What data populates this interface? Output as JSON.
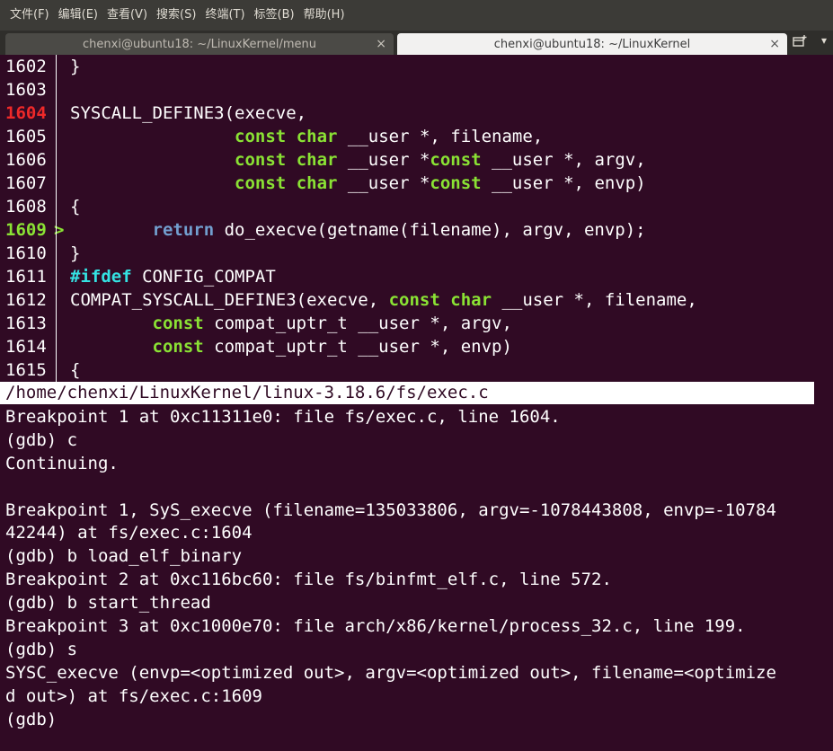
{
  "menubar": {
    "items": [
      "文件(F)",
      "编辑(E)",
      "查看(V)",
      "搜索(S)",
      "终端(T)",
      "标签(B)",
      "帮助(H)"
    ]
  },
  "tabs": [
    {
      "title": "chenxi@ubuntu18: ~/LinuxKernel/menu",
      "close": "×"
    },
    {
      "title": "chenxi@ubuntu18: ~/LinuxKernel",
      "close": "×"
    }
  ],
  "tab_menu": "▾",
  "code": [
    {
      "ln": "1602",
      "type": "normal",
      "parts": [
        [
          "",
          "}"
        ]
      ]
    },
    {
      "ln": "1603",
      "type": "normal",
      "parts": []
    },
    {
      "ln": "1604",
      "type": "bp",
      "parts": [
        [
          "",
          "SYSCALL_DEFINE3(execve,"
        ]
      ]
    },
    {
      "ln": "1605",
      "type": "normal",
      "parts": [
        [
          "",
          "                "
        ],
        [
          "kw",
          "const"
        ],
        [
          "",
          " "
        ],
        [
          "kw",
          "char"
        ],
        [
          "",
          " __user *, filename,"
        ]
      ]
    },
    {
      "ln": "1606",
      "type": "normal",
      "parts": [
        [
          "",
          "                "
        ],
        [
          "kw",
          "const"
        ],
        [
          "",
          " "
        ],
        [
          "kw",
          "char"
        ],
        [
          "",
          " __user *"
        ],
        [
          "kw",
          "const"
        ],
        [
          "",
          " __user *, argv,"
        ]
      ]
    },
    {
      "ln": "1607",
      "type": "normal",
      "parts": [
        [
          "",
          "                "
        ],
        [
          "kw",
          "const"
        ],
        [
          "",
          " "
        ],
        [
          "kw",
          "char"
        ],
        [
          "",
          " __user *"
        ],
        [
          "kw",
          "const"
        ],
        [
          "",
          " __user *, envp)"
        ]
      ]
    },
    {
      "ln": "1608",
      "type": "normal",
      "parts": [
        [
          "",
          "{"
        ]
      ]
    },
    {
      "ln": "1609",
      "type": "cur",
      "marker": ">",
      "parts": [
        [
          "",
          "        "
        ],
        [
          "kw2",
          "return"
        ],
        [
          "",
          " do_execve(getname(filename), argv, envp);"
        ]
      ]
    },
    {
      "ln": "1610",
      "type": "normal",
      "parts": [
        [
          "",
          "}"
        ]
      ]
    },
    {
      "ln": "1611",
      "type": "normal",
      "parts": [
        [
          "pp",
          "#ifdef"
        ],
        [
          "",
          " CONFIG_COMPAT"
        ]
      ]
    },
    {
      "ln": "1612",
      "type": "normal",
      "parts": [
        [
          "",
          "COMPAT_SYSCALL_DEFINE3(execve, "
        ],
        [
          "kw",
          "const"
        ],
        [
          "",
          " "
        ],
        [
          "kw",
          "char"
        ],
        [
          "",
          " __user *, filename,"
        ]
      ]
    },
    {
      "ln": "1613",
      "type": "normal",
      "parts": [
        [
          "",
          "        "
        ],
        [
          "kw",
          "const"
        ],
        [
          "",
          " compat_uptr_t __user *, argv,"
        ]
      ]
    },
    {
      "ln": "1614",
      "type": "normal",
      "parts": [
        [
          "",
          "        "
        ],
        [
          "kw",
          "const"
        ],
        [
          "",
          " compat_uptr_t __user *, envp)"
        ]
      ]
    },
    {
      "ln": "1615",
      "type": "normal",
      "parts": [
        [
          "",
          "{"
        ]
      ]
    }
  ],
  "status_bar": "/home/chenxi/LinuxKernel/linux-3.18.6/fs/exec.c",
  "gdb_output": [
    "Breakpoint 1 at 0xc11311e0: file fs/exec.c, line 1604.",
    "(gdb) c",
    "Continuing.",
    "",
    "Breakpoint 1, SyS_execve (filename=135033806, argv=-1078443808, envp=-10784",
    "42244) at fs/exec.c:1604",
    "(gdb) b load_elf_binary",
    "Breakpoint 2 at 0xc116bc60: file fs/binfmt_elf.c, line 572.",
    "(gdb) b start_thread",
    "Breakpoint 3 at 0xc1000e70: file arch/x86/kernel/process_32.c, line 199.",
    "(gdb) s",
    "SYSC_execve (envp=<optimized out>, argv=<optimized out>, filename=<optimize",
    "d out>) at fs/exec.c:1609",
    "(gdb)"
  ]
}
